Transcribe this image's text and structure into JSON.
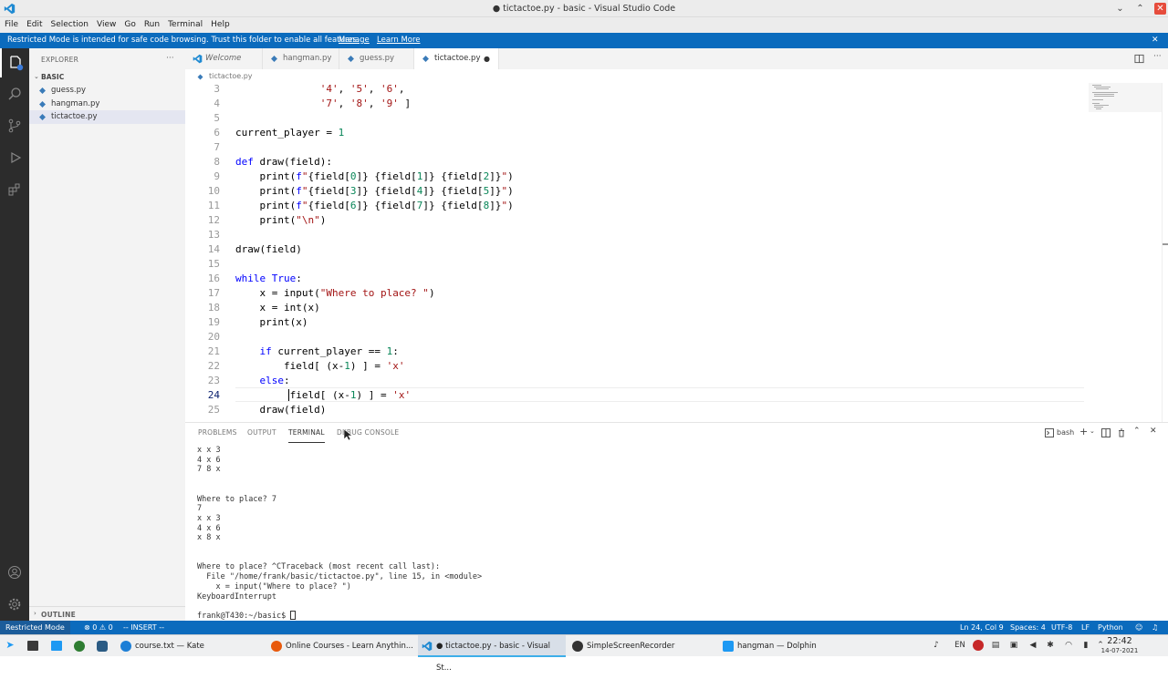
{
  "window": {
    "title": "● tictactoe.py - basic - Visual Studio Code",
    "minimize": "⌄",
    "maximize": "⌃",
    "close": "✕"
  },
  "menu": [
    "File",
    "Edit",
    "Selection",
    "View",
    "Go",
    "Run",
    "Terminal",
    "Help"
  ],
  "banner": {
    "text": "Restricted Mode is intended for safe code browsing. Trust this folder to enable all features.",
    "manage": "Manage",
    "learn_more": "Learn More",
    "close": "✕"
  },
  "sidebar": {
    "header": "EXPLORER",
    "more": "···",
    "folder": "BASIC",
    "files": [
      "guess.py",
      "hangman.py",
      "tictactoe.py"
    ],
    "outline": "OUTLINE"
  },
  "tabs": [
    {
      "label": "Welcome"
    },
    {
      "label": "hangman.py"
    },
    {
      "label": "guess.py"
    },
    {
      "label": "tictactoe.py",
      "dirty": "●"
    }
  ],
  "breadcrumb": "tictactoe.py",
  "editor": {
    "line_numbers": [
      "3",
      "4",
      "5",
      "6",
      "7",
      "8",
      "9",
      "10",
      "11",
      "12",
      "13",
      "14",
      "15",
      "16",
      "17",
      "18",
      "19",
      "20",
      "21",
      "22",
      "23",
      "24",
      "25"
    ],
    "current_line": "24"
  },
  "panel": {
    "tabs": [
      "PROBLEMS",
      "OUTPUT",
      "TERMINAL",
      "DEBUG CONSOLE"
    ],
    "shell": "bash",
    "terminal_lines": [
      "x x 3",
      "4 x 6",
      "7 8 x",
      "",
      "",
      "Where to place? 7",
      "7",
      "x x 3",
      "4 x 6",
      "x 8 x",
      "",
      "",
      "Where to place? ^CTraceback (most recent call last):",
      "  File \"/home/frank/basic/tictactoe.py\", line 15, in <module>",
      "    x = input(\"Where to place? \")",
      "KeyboardInterrupt",
      "",
      "frank@T430:~/basic$ "
    ]
  },
  "status": {
    "restricted": "Restricted Mode",
    "problems": "⊗ 0 ⚠ 0",
    "mode": "-- INSERT --",
    "position": "Ln 24, Col 9",
    "spaces": "Spaces: 4",
    "encoding": "UTF-8",
    "eol": "LF",
    "language": "Python"
  },
  "taskbar": {
    "tasks": [
      "course.txt — Kate",
      "Online Courses - Learn Anythin...",
      "● tictactoe.py - basic - Visual St...",
      "SimpleScreenRecorder",
      "hangman — Dolphin"
    ],
    "lang": "EN",
    "clock": "22:42",
    "date": "14-07-2021"
  }
}
